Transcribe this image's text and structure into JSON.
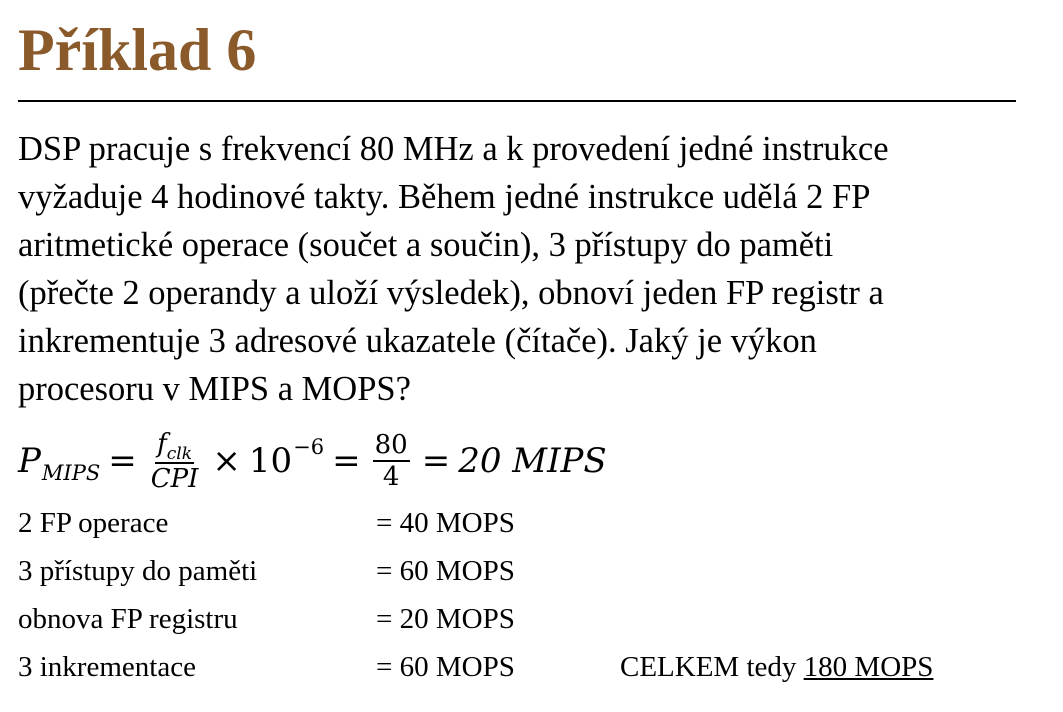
{
  "title": "Příklad 6",
  "paragraph_lines": [
    "DSP pracuje s frekvencí 80 MHz a k provedení jedné instrukce",
    "vyžaduje 4 hodinové takty. Během jedné instrukce udělá 2 FP",
    "aritmetické operace (součet a součin), 3 přístupy do paměti",
    "(přečte 2 operandy a uloží výsledek), obnoví jeden FP registr a",
    "inkrementuje 3 adresové ukazatele (čítače). Jaký je výkon",
    "procesoru v MIPS a MOPS?"
  ],
  "formula": {
    "lhs": "P",
    "lhs_sub": "MIPS",
    "eq1": "=",
    "frac1_num": "f",
    "frac1_num_sub": "clk",
    "frac1_den": "CPI",
    "times": "×",
    "power_base": "10",
    "power_exp": "−6",
    "eq2": "=",
    "frac2_num": "80",
    "frac2_den": "4",
    "eq3": "=",
    "result": "20 MIPS"
  },
  "rows": [
    {
      "label": "2 FP operace",
      "value": "= 40 MOPS"
    },
    {
      "label": "3 přístupy do paměti",
      "value": "= 60 MOPS"
    },
    {
      "label": "obnova FP registru",
      "value": "= 20 MOPS"
    },
    {
      "label": "3 inkrementace",
      "value": "= 60 MOPS"
    }
  ],
  "total": {
    "prefix": "CELKEM tedy",
    "value": "180 MOPS"
  },
  "colors": {
    "title": "#8a5a2b",
    "text": "#000000",
    "background": "#ffffff"
  }
}
